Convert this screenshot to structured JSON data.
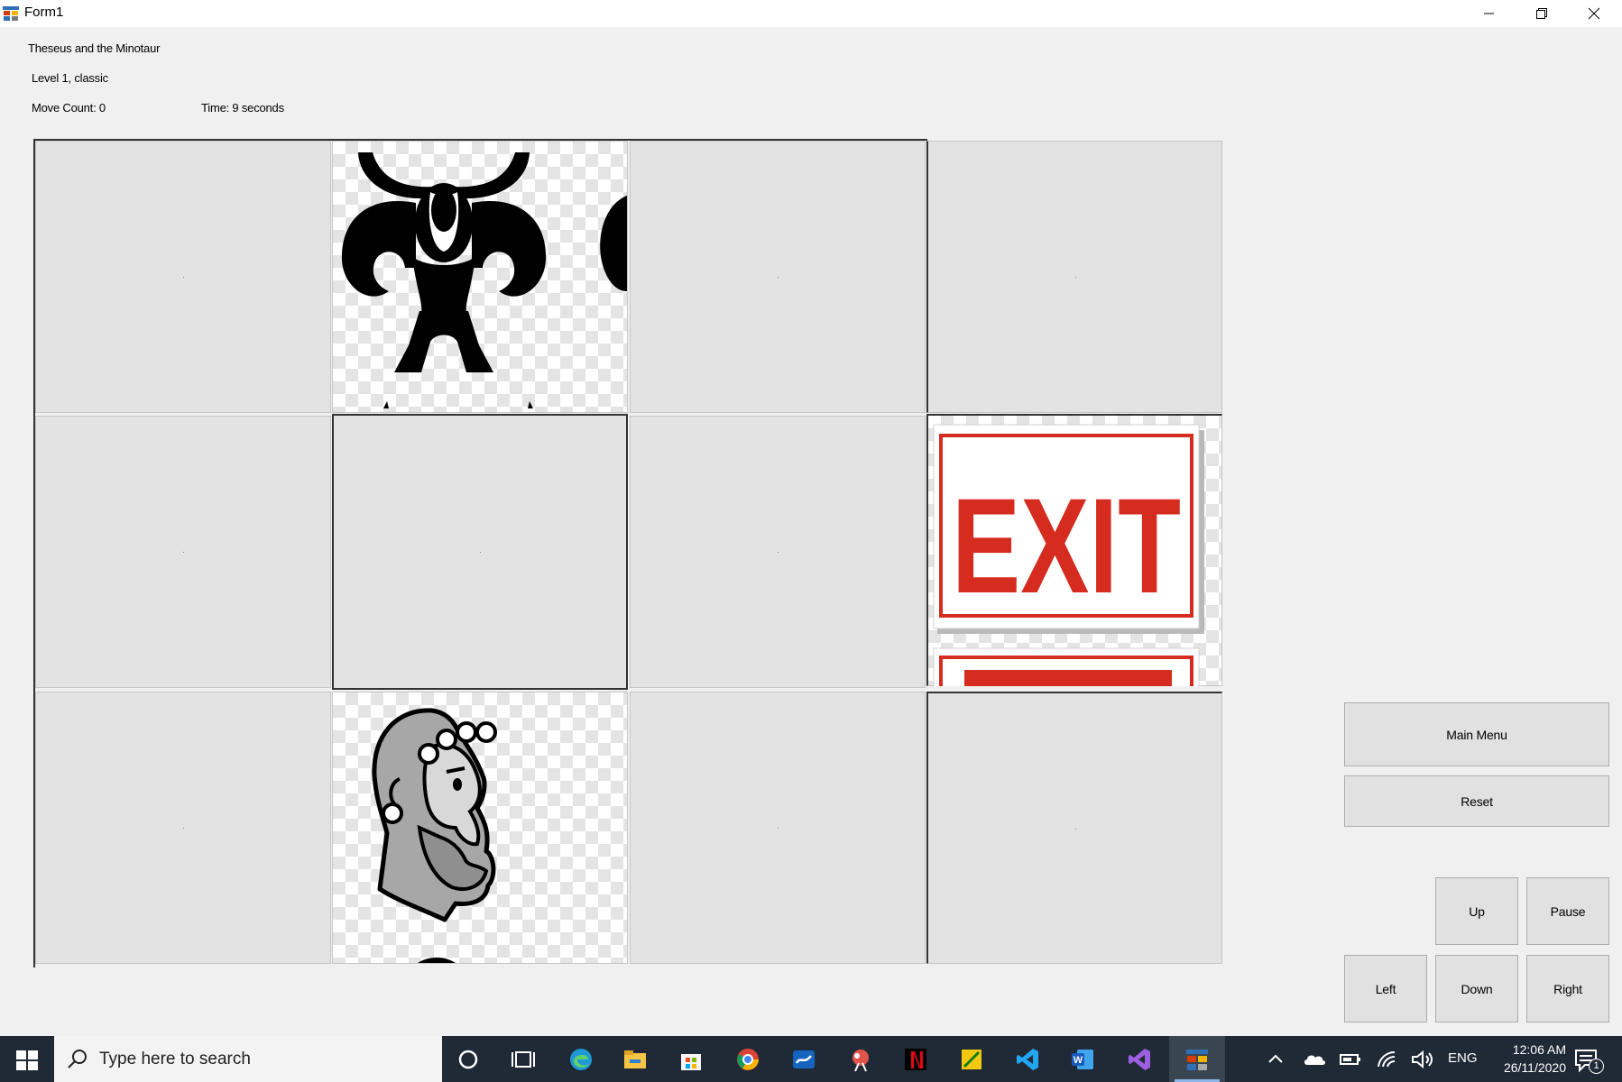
{
  "window": {
    "title": "Form1"
  },
  "game": {
    "name": "Theseus and the Minotaur",
    "level": "Level 1, classic",
    "move_count": "Move Count: 0",
    "time": "Time: 9 seconds"
  },
  "grid": {
    "rows": 3,
    "columns": 4,
    "minotaur_cell": "row 1, column 2",
    "exit_cell": "row 2, column 4",
    "theseus_cell": "row 3, column 2",
    "exit_sign_text": "EXIT"
  },
  "buttons": {
    "main_menu": "Main Menu",
    "reset": "Reset",
    "up": "Up",
    "pause": "Pause",
    "left": "Left",
    "down": "Down",
    "right": "Right"
  },
  "taskbar": {
    "search_placeholder": "Type here to search",
    "language": "ENG",
    "time": "12:06 AM",
    "date": "26/11/2020",
    "notification_count": "1"
  },
  "colors": {
    "exit_red": "#d62b1f",
    "taskbar": "#202a36",
    "cell_gray": "#e3e3e3"
  }
}
